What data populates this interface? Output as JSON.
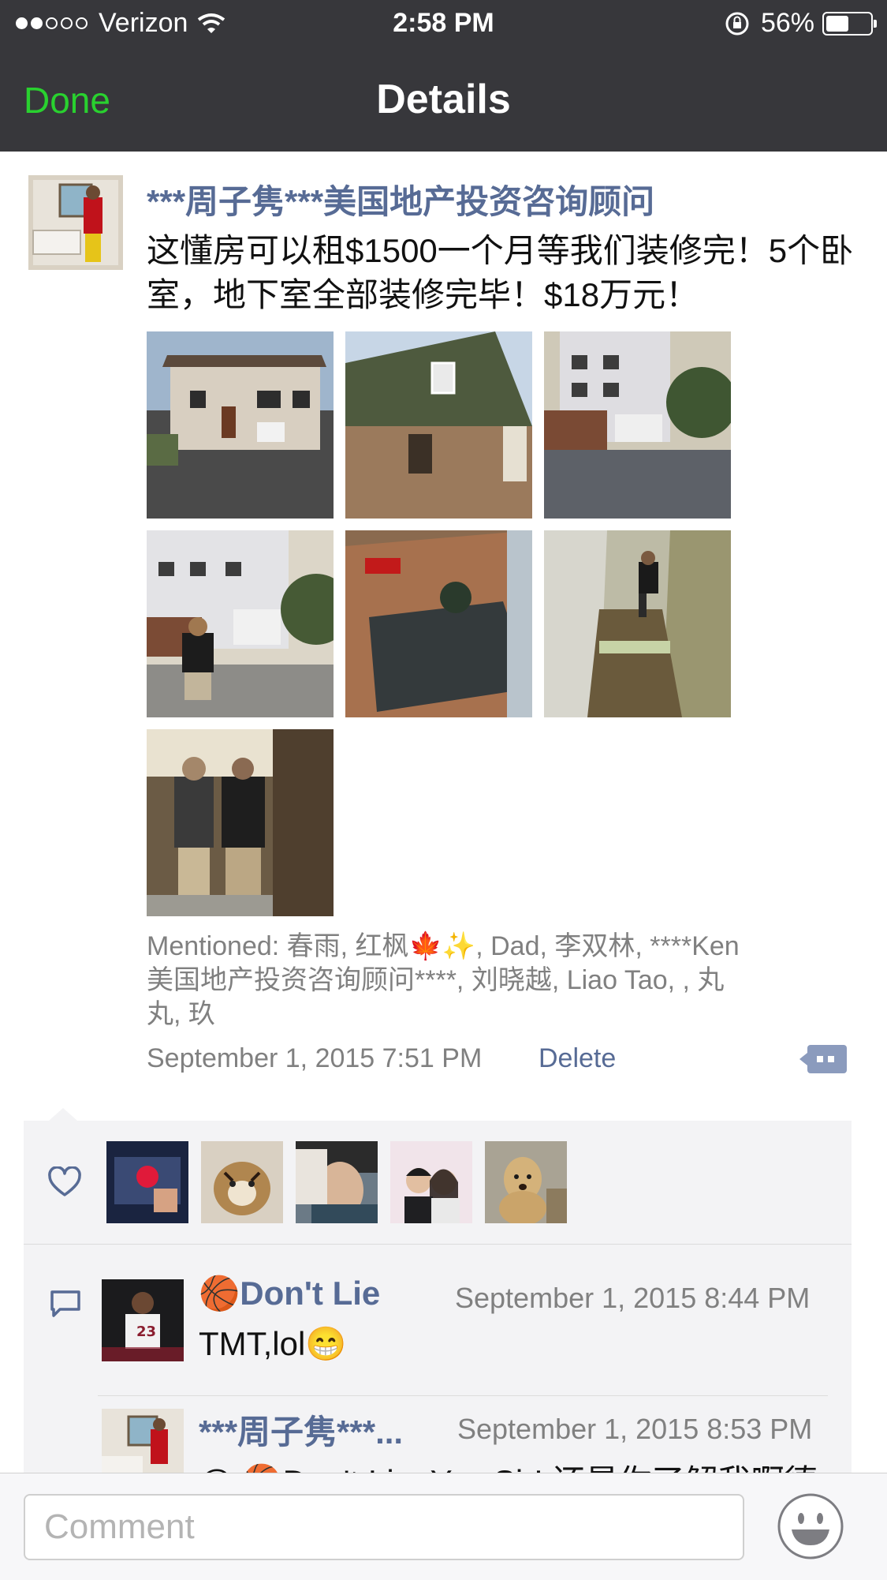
{
  "status_bar": {
    "carrier": "Verizon",
    "time": "2:58 PM",
    "battery": "56%",
    "battery_level": 0.56
  },
  "nav": {
    "done_label": "Done",
    "title": "Details"
  },
  "post": {
    "author": "***周子隽***美国地产投资咨询顾问",
    "text": "这懂房可以租$1500一个月等我们装修完！5个卧室，地下室全部装修完毕！$18万元！",
    "photo_count": 7,
    "mentioned": "Mentioned: 春雨, 红枫🍁✨, Dad, 李双林, ****Ken美国地产投资咨询顾问****, 刘晓越, Liao Tao, , 丸丸, 玖",
    "time": "September 1, 2015 7:51 PM",
    "delete_label": "Delete"
  },
  "likes": {
    "count": 5
  },
  "comments": [
    {
      "name": "🏀Don't Lie",
      "time": "September 1, 2015 8:44 PM",
      "text": "TMT,lol😁"
    },
    {
      "name": "***周子隽***...",
      "time": "September 1, 2015 8:53 PM",
      "text": "@ 🏀Don't Lie: Yes Sir! 还是你了解我啊德"
    }
  ],
  "comment_input": {
    "placeholder": "Comment"
  },
  "colors": {
    "nav_bg": "#37373b",
    "done_green": "#29d12f",
    "link_blue": "#576b95",
    "comment_bg": "#f3f3f5"
  },
  "icons": [
    "wifi-icon",
    "rotation-lock-icon",
    "battery-icon",
    "more-actions-icon",
    "heart-icon",
    "comment-bubble-icon",
    "emoji-face-icon"
  ]
}
